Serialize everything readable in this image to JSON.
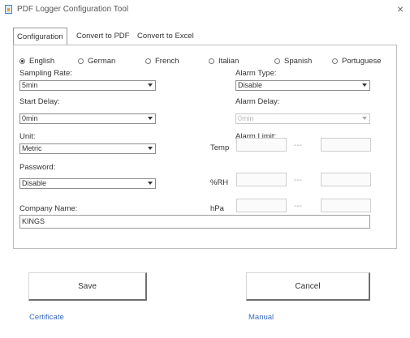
{
  "window": {
    "title": "PDF Logger Configuration Tool",
    "close_glyph": "×",
    "icon": "app-icon"
  },
  "tabs": [
    {
      "label": "Configuration",
      "active": true
    },
    {
      "label": "Convert to PDF"
    },
    {
      "label": "Convert to Excel"
    }
  ],
  "languages": [
    {
      "label": "English",
      "selected": true
    },
    {
      "label": "German"
    },
    {
      "label": "French"
    },
    {
      "label": "Italian"
    },
    {
      "label": "Spanish"
    },
    {
      "label": "Portuguese"
    }
  ],
  "form": {
    "sampling_rate": {
      "label": "Sampling Rate:",
      "value": "5min"
    },
    "start_delay": {
      "label": "Start Delay:",
      "value": "0min"
    },
    "unit": {
      "label": "Unit:",
      "value": "Metric"
    },
    "password": {
      "label": "Password:",
      "value": "Disable"
    },
    "company_name": {
      "label": "Company Name:",
      "value": "KINGS"
    },
    "alarm_type": {
      "label": "Alarm Type:",
      "value": "Disable"
    },
    "alarm_delay": {
      "label": "Alarm Delay:",
      "value": "0min"
    },
    "alarm_limit": {
      "label": "Alarm Limit:",
      "separator": "---",
      "rows": [
        {
          "label": "Temp"
        },
        {
          "label": "%RH"
        },
        {
          "label": "hPa"
        }
      ]
    }
  },
  "buttons": {
    "save": "Save",
    "cancel": "Cancel"
  },
  "links": {
    "certificate": "Certificate",
    "manual": "Manual"
  }
}
